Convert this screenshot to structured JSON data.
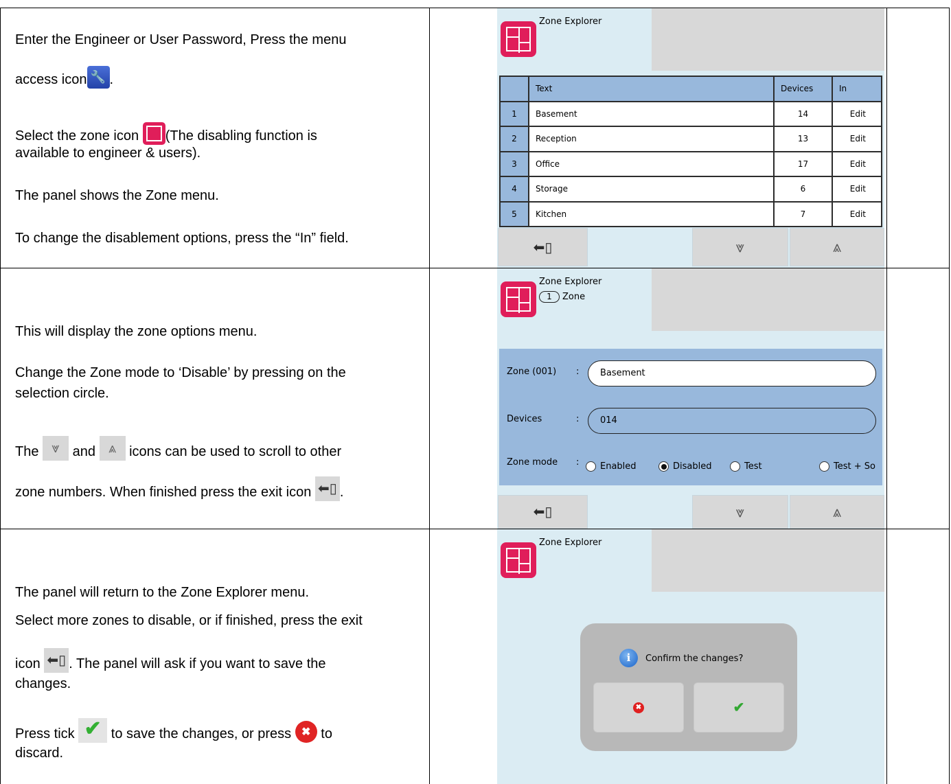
{
  "row1": {
    "line1": "Enter the Engineer or User Password, Press the menu",
    "line2a": "access icon",
    "line2b": ".",
    "line3a": "Select the zone icon ",
    "line3b": "(The disabling function is",
    "line4": "available to engineer & users).",
    "line5": "The panel shows the Zone menu.",
    "line6": "To change the disablement options, press the “In” field.",
    "icons": [
      "menu-access-icon",
      "zone-icon"
    ]
  },
  "row2": {
    "line1": "This will display the zone options menu.",
    "line2": "Change the Zone mode to ‘Disable’ by pressing on the",
    "line3": "selection circle.",
    "line4a": "The ",
    "line4b": " and ",
    "line4c": " icons can be used to scroll to other",
    "line5a": "zone numbers. When finished press the exit icon ",
    "line5b": ".",
    "icons": [
      "scroll-down-icon",
      "scroll-up-icon",
      "exit-icon"
    ]
  },
  "row3": {
    "line1": "The panel will return to the Zone Explorer menu.",
    "line2": "Select more zones to disable, or if finished, press the exit",
    "line3a": "icon ",
    "line3b": ". The panel will ask if you want to save the",
    "line4": "changes.",
    "line5a": "Press tick ",
    "line5b": " to save the changes, or press ",
    "line5c": " to",
    "line6": "discard.",
    "icons": [
      "tick-icon",
      "cancel-icon"
    ]
  },
  "screen1": {
    "title": "Zone Explorer",
    "headers": [
      "",
      "Text",
      "Devices",
      "In"
    ],
    "rows": [
      {
        "num": "1",
        "text": "Basement",
        "devices": "14",
        "in": "Edit"
      },
      {
        "num": "2",
        "text": "Reception",
        "devices": "13",
        "in": "Edit"
      },
      {
        "num": "3",
        "text": "Office",
        "devices": "17",
        "in": "Edit"
      },
      {
        "num": "4",
        "text": "Storage",
        "devices": "6",
        "in": "Edit"
      },
      {
        "num": "5",
        "text": "Kitchen",
        "devices": "7",
        "in": "Edit"
      }
    ]
  },
  "screen2": {
    "title": "Zone Explorer",
    "zone_number": "1",
    "zone_word": "Zone",
    "zone_label": "Zone (001)",
    "colon": ":",
    "zone_value": "Basement",
    "devices_label": "Devices",
    "devices_value": "014",
    "mode_label": "Zone mode",
    "modes": [
      "Enabled",
      "Disabled",
      "Test",
      "Test + So"
    ],
    "selected_mode": "Disabled"
  },
  "screen3": {
    "title": "Zone Explorer",
    "dialog_message": "Confirm the changes?"
  },
  "colors": {
    "screen_bg": "#dbecf3",
    "table_header": "#98b8dc",
    "zone_icon": "#e01e5a",
    "tick": "#33a833",
    "cancel": "#e02020"
  }
}
